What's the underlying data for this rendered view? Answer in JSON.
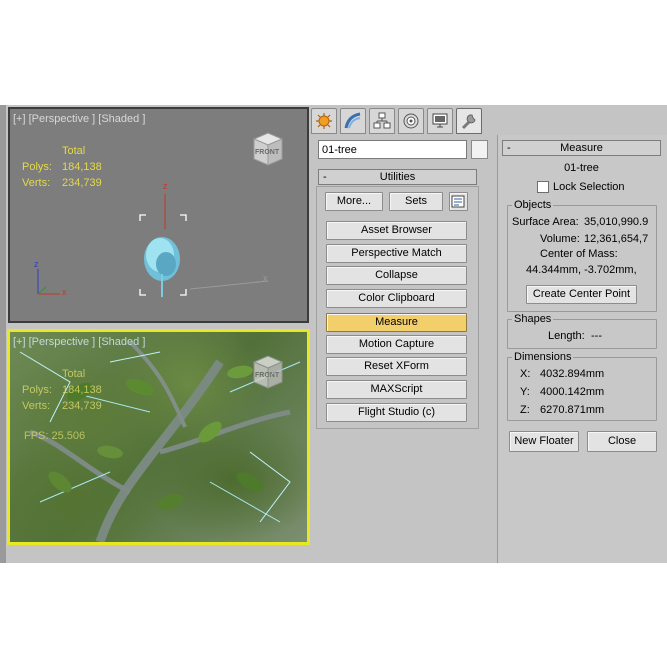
{
  "viewport_top": {
    "label": "[+] [Perspective ] [Shaded ]",
    "stats_total": "Total",
    "polys_label": "Polys:",
    "polys_value": "184,138",
    "verts_label": "Verts:",
    "verts_value": "234,739",
    "viewcube_label": "FRONT",
    "axis_x": "x",
    "axis_y": "y",
    "axis_z": "z"
  },
  "viewport_bottom": {
    "label": "[+] [Perspective ] [Shaded ]",
    "stats_total": "Total",
    "polys_label": "Polys:",
    "polys_value": "184,138",
    "verts_label": "Verts:",
    "verts_value": "234,739",
    "fps_label": "FPS:",
    "fps_value": "25.506",
    "viewcube_label": "FRONT"
  },
  "command_panel": {
    "tabs": [
      "create-icon",
      "modify-icon",
      "hierarchy-icon",
      "motion-icon",
      "display-icon",
      "utilities-icon"
    ],
    "object_name": "01-tree"
  },
  "utilities": {
    "title": "Utilities",
    "more_label": "More...",
    "sets_label": "Sets",
    "items": [
      "Asset Browser",
      "Perspective Match",
      "Collapse",
      "Color Clipboard",
      "Measure",
      "Motion Capture",
      "Reset XForm",
      "MAXScript",
      "Flight Studio (c)"
    ],
    "active_item": "Measure"
  },
  "measure": {
    "title": "Measure",
    "object_name": "01-tree",
    "lock_selection": "Lock Selection",
    "objects_title": "Objects",
    "surface_area_label": "Surface Area:",
    "surface_area_value": "35,010,990.9",
    "volume_label": "Volume:",
    "volume_value": "12,361,654,7",
    "center_of_mass_label": "Center of Mass:",
    "center_of_mass_value": "44.344mm, -3.702mm,",
    "create_center_point": "Create Center Point",
    "shapes_title": "Shapes",
    "length_label": "Length:",
    "length_value": "---",
    "dimensions_title": "Dimensions",
    "x_label": "X:",
    "x_value": "4032.894mm",
    "y_label": "Y:",
    "y_value": "4000.142mm",
    "z_label": "Z:",
    "z_value": "6270.871mm",
    "new_floater": "New Floater",
    "close": "Close"
  }
}
